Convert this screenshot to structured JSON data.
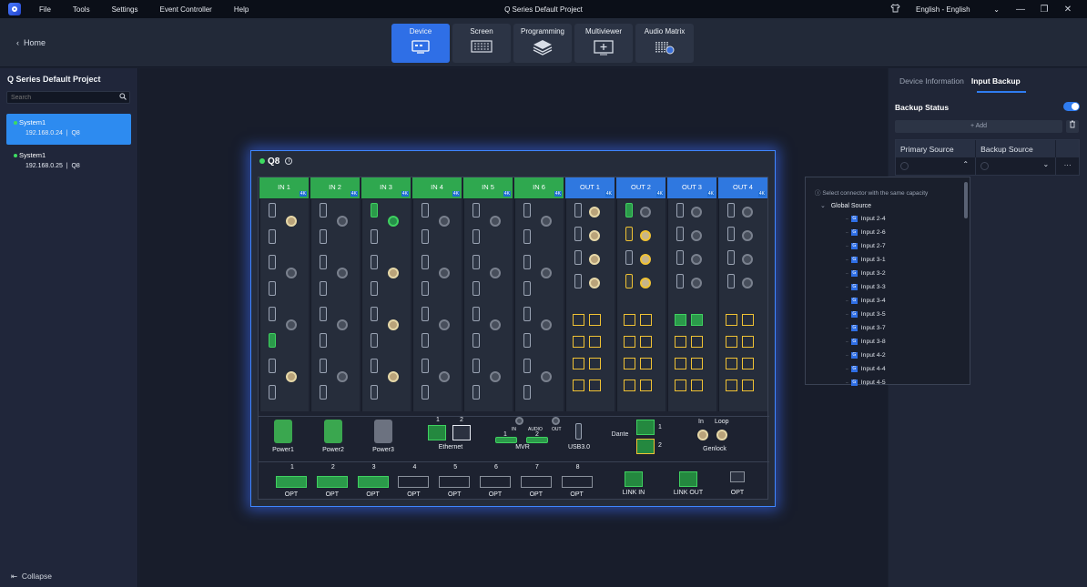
{
  "titlebar": {
    "menu": [
      "File",
      "Tools",
      "Settings",
      "Event Controller",
      "Help"
    ],
    "title": "Q Series Default Project",
    "language": "English - English",
    "icons": [
      "shirt-icon",
      "minimize-icon",
      "restore-icon",
      "close-icon"
    ]
  },
  "nav": {
    "home": "Home",
    "tabs": [
      {
        "label": "Device",
        "icon": "device-icon",
        "active": true
      },
      {
        "label": "Screen",
        "icon": "screen-grid-icon",
        "active": false
      },
      {
        "label": "Programming",
        "icon": "layers-icon",
        "active": false
      },
      {
        "label": "Multiviewer",
        "icon": "multiviewer-icon",
        "active": false
      },
      {
        "label": "Audio Matrix",
        "icon": "audio-matrix-icon",
        "active": false
      }
    ]
  },
  "sidebar": {
    "project_title": "Q Series Default Project",
    "search_placeholder": "Search",
    "devices": [
      {
        "name": "System1",
        "ip": "192.168.0.24",
        "model": "Q8",
        "selected": true
      },
      {
        "name": "System1",
        "ip": "192.168.0.25",
        "model": "Q8",
        "selected": false
      }
    ],
    "collapse": "Collapse"
  },
  "device": {
    "name": "Q8",
    "inputs": [
      "IN 1",
      "IN 2",
      "IN 3",
      "IN 4",
      "IN 5",
      "IN 6"
    ],
    "outputs": [
      "OUT 1",
      "OUT 2",
      "OUT 3",
      "OUT 4"
    ],
    "badge_4k": "4K",
    "power": [
      "Power1",
      "Power2",
      "Power3"
    ],
    "ethernet": {
      "label": "Ethernet",
      "ports": [
        "1",
        "2"
      ]
    },
    "audio": {
      "in": "IN",
      "mid": "AUDIO",
      "out": "OUT"
    },
    "mvr": {
      "label": "MVR",
      "ports": [
        "1",
        "2"
      ]
    },
    "usb": "USB3.0",
    "dante": {
      "label": "Dante",
      "ports": [
        "1",
        "2"
      ]
    },
    "genlock": {
      "label": "Genlock",
      "in": "In",
      "loop": "Loop"
    },
    "opt_ports": [
      "1",
      "2",
      "3",
      "4",
      "5",
      "6",
      "7",
      "8"
    ],
    "opt_label": "OPT",
    "link_in": "LINK IN",
    "link_out": "LINK OUT",
    "opt_extra": "OPT"
  },
  "right_panel": {
    "tabs": [
      "Device Information",
      "Input Backup"
    ],
    "active_tab": "Input Backup",
    "backup_status": "Backup Status",
    "backup_enabled": true,
    "add": "+ Add",
    "columns": [
      "Primary Source",
      "Backup Source"
    ],
    "more": "···"
  },
  "dropdown": {
    "hint": "Select connector with the same capacity",
    "group": "Global Source",
    "items": [
      "Input 2-4",
      "Input 2-6",
      "Input 2-7",
      "Input 3-1",
      "Input 3-2",
      "Input 3-3",
      "Input 3-4",
      "Input 3-5",
      "Input 3-7",
      "Input 3-8",
      "Input 4-2",
      "Input 4-4",
      "Input 4-5"
    ]
  },
  "colors": {
    "accent": "#2f6fe6",
    "input_green": "#2fa84f",
    "output_blue": "#2f78e0",
    "status_green": "#3ddc61",
    "highlight_yellow": "#f0c234"
  }
}
